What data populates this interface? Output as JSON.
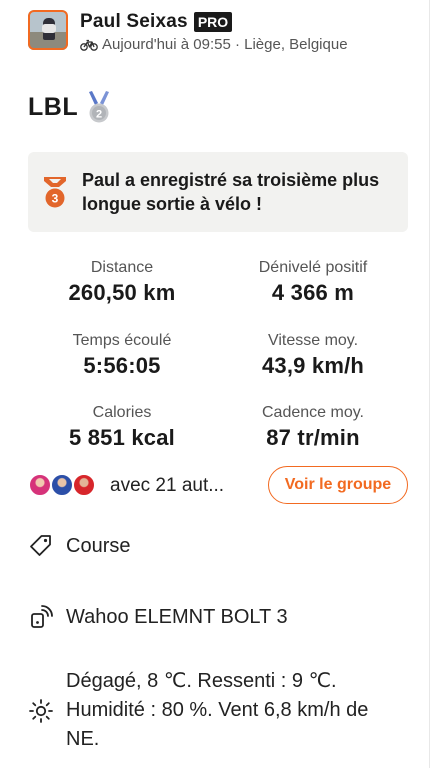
{
  "header": {
    "athlete_name": "Paul  Seixas",
    "badge": "PRO",
    "meta": "Aujourd'hui à 09:55 · Liège, Belgique",
    "activity_icon": "bike-icon",
    "avatar_icon": "avatar"
  },
  "activity": {
    "title": "LBL",
    "medal_icon": "silver-medal-icon",
    "medal_rank": "2"
  },
  "achievement": {
    "icon": "bronze-medal-icon",
    "rank": "3",
    "text": "Paul  a enregistré sa troisième plus longue sortie à vélo !"
  },
  "stats": [
    {
      "label": "Distance",
      "value": "260,50 km"
    },
    {
      "label": "Dénivelé positif",
      "value": "4 366 m"
    },
    {
      "label": "Temps écoulé",
      "value": "5:56:05"
    },
    {
      "label": "Vitesse moy.",
      "value": "43,9 km/h"
    },
    {
      "label": "Calories",
      "value": "5 851 kcal"
    },
    {
      "label": "Cadence moy.",
      "value": "87 tr/min"
    }
  ],
  "group": {
    "with_text": "avec 21 aut...",
    "button_label": "Voir le groupe"
  },
  "details": {
    "tag_icon": "tag-icon",
    "race_label": "Course",
    "device_icon": "device-icon",
    "device": "Wahoo ELEMNT BOLT 3",
    "weather_icon": "sun-icon",
    "weather": "Dégagé, 8  ℃. Ressenti : 9  ℃. Humidité : 80 %. Vent 6,8 km/h de NE."
  },
  "colors": {
    "accent": "#f26a21",
    "text": "#1a1a1a",
    "muted": "#555555",
    "box_bg": "#f2f2f0"
  }
}
